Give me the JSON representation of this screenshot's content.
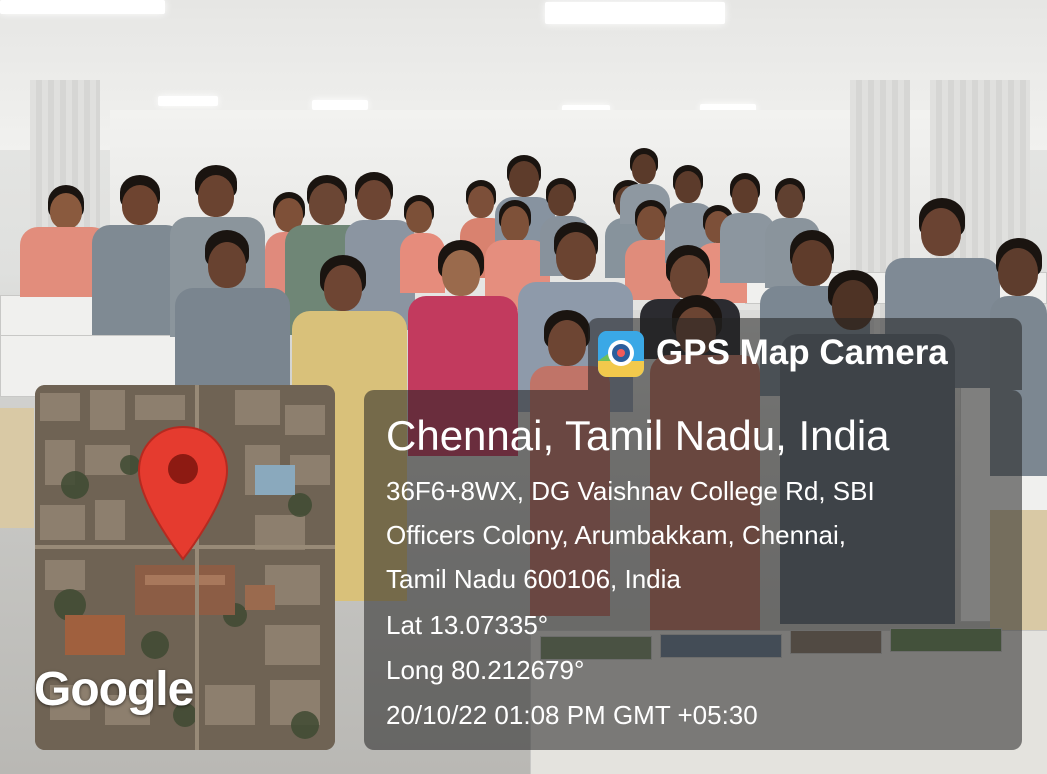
{
  "overlay": {
    "app_name": "GPS Map Camera",
    "app_icon": "gps-map-camera-icon",
    "city": "Chennai, Tamil Nadu, India",
    "address_lines": [
      "36F6+8WX, DG Vaishnav College Rd, SBI",
      "Officers Colony, Arumbakkam, Chennai,",
      "Tamil Nadu 600106, India"
    ],
    "latitude": "Lat 13.07335°",
    "longitude": "Long 80.212679°",
    "datetime": "20/10/22 01:08 PM GMT +05:30",
    "map_watermark": "Google",
    "map_pin_icon": "map-pin-icon"
  },
  "colors": {
    "pin": "#e53b2f",
    "pin_dot": "#8d1a12",
    "panel": "#232323"
  }
}
